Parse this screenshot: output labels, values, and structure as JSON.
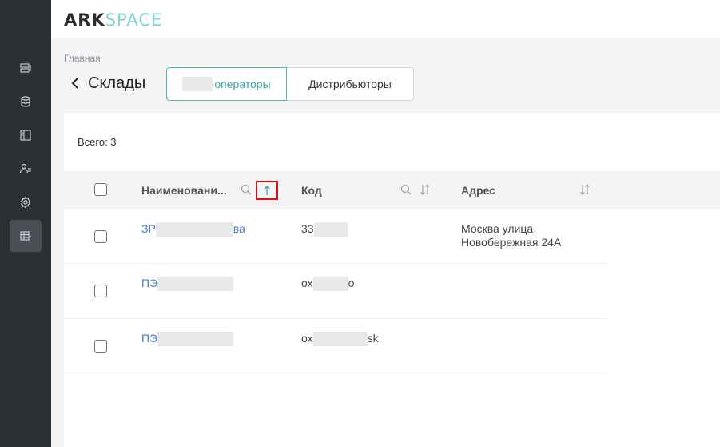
{
  "app": {
    "logo_part1": "ARK",
    "logo_part2": "SPACE"
  },
  "sidebar": {
    "items": [
      {
        "icon": "list-icon",
        "active": false
      },
      {
        "icon": "database-icon",
        "active": false
      },
      {
        "icon": "panel-icon",
        "active": false
      },
      {
        "icon": "users-icon",
        "active": false
      },
      {
        "icon": "gear-icon",
        "active": false
      },
      {
        "icon": "table-icon",
        "active": true
      }
    ]
  },
  "breadcrumb": "Главная",
  "page": {
    "title": "Склады"
  },
  "tabs": [
    {
      "label": "операторы",
      "active": true
    },
    {
      "label": "Дистрибьюторы",
      "active": false
    }
  ],
  "summary": {
    "total": "Всего: 3"
  },
  "table": {
    "columns": {
      "name": "Наименовани...",
      "code": "Код",
      "address": "Адрес"
    },
    "rows": [
      {
        "name_start": "ЗР",
        "name_end": "ва",
        "code_start": "33",
        "code_end": "",
        "address_line1": "Москва улица",
        "address_line2": "Новобережная 24А"
      },
      {
        "name_start": "ПЭ",
        "name_end": "",
        "code_start": "ох",
        "code_end": "о",
        "address_line1": "",
        "address_line2": ""
      },
      {
        "name_start": "ПЭ",
        "name_end": "",
        "code_start": "ох",
        "code_end": "sk",
        "address_line1": "",
        "address_line2": ""
      }
    ]
  },
  "colors": {
    "accent": "#3aaaa6",
    "link": "#3f7fd1",
    "sidebar": "#2c2f33",
    "highlight": "#dd1111"
  }
}
